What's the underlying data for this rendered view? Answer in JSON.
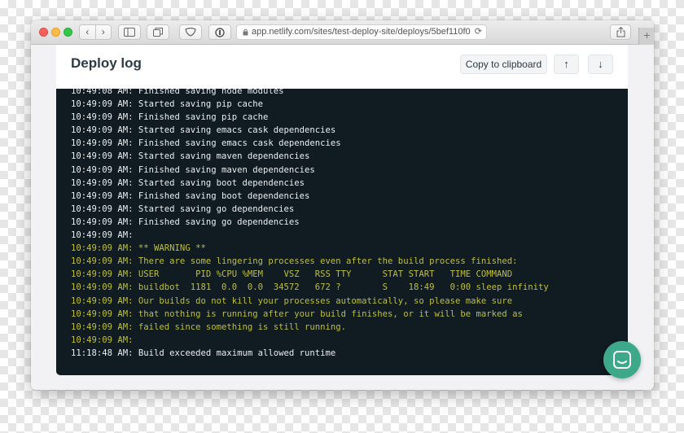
{
  "browser": {
    "url": "app.netlify.com/sites/test-deploy-site/deploys/5bef110f0",
    "nav_back": "‹",
    "nav_forward": "›",
    "new_tab": "+"
  },
  "page": {
    "title": "Deploy log",
    "copy_label": "Copy to clipboard",
    "scroll_up_label": "↑",
    "scroll_down_label": "↓"
  },
  "colors": {
    "log_text": "#e9eef0",
    "warning_text": "#bfbf35",
    "terminal_bg": "#101c22",
    "chat_button": "#3da98a"
  },
  "log": [
    {
      "text": "10:49:08 AM: Finished saving node modules",
      "level": "info"
    },
    {
      "text": "10:49:09 AM: Started saving pip cache",
      "level": "info"
    },
    {
      "text": "10:49:09 AM: Finished saving pip cache",
      "level": "info"
    },
    {
      "text": "10:49:09 AM: Started saving emacs cask dependencies",
      "level": "info"
    },
    {
      "text": "10:49:09 AM: Finished saving emacs cask dependencies",
      "level": "info"
    },
    {
      "text": "10:49:09 AM: Started saving maven dependencies",
      "level": "info"
    },
    {
      "text": "10:49:09 AM: Finished saving maven dependencies",
      "level": "info"
    },
    {
      "text": "10:49:09 AM: Started saving boot dependencies",
      "level": "info"
    },
    {
      "text": "10:49:09 AM: Finished saving boot dependencies",
      "level": "info"
    },
    {
      "text": "10:49:09 AM: Started saving go dependencies",
      "level": "info"
    },
    {
      "text": "10:49:09 AM: Finished saving go dependencies",
      "level": "info"
    },
    {
      "text": "10:49:09 AM: ",
      "level": "info"
    },
    {
      "text": "10:49:09 AM: ** WARNING **",
      "level": "warning"
    },
    {
      "text": "10:49:09 AM: There are some lingering processes even after the build process finished:",
      "level": "warning"
    },
    {
      "text": "10:49:09 AM: USER       PID %CPU %MEM    VSZ   RSS TTY      STAT START   TIME COMMAND",
      "level": "warning"
    },
    {
      "text": "10:49:09 AM: buildbot  1181  0.0  0.0  34572   672 ?        S    18:49   0:00 sleep infinity",
      "level": "warning"
    },
    {
      "text": "10:49:09 AM: Our builds do not kill your processes automatically, so please make sure",
      "level": "warning"
    },
    {
      "text": "10:49:09 AM: that nothing is running after your build finishes, or it will be marked as",
      "level": "warning"
    },
    {
      "text": "10:49:09 AM: failed since something is still running.",
      "level": "warning"
    },
    {
      "text": "10:49:09 AM: ",
      "level": "warning"
    },
    {
      "text": "11:18:48 AM: Build exceeded maximum allowed runtime",
      "level": "info"
    }
  ]
}
